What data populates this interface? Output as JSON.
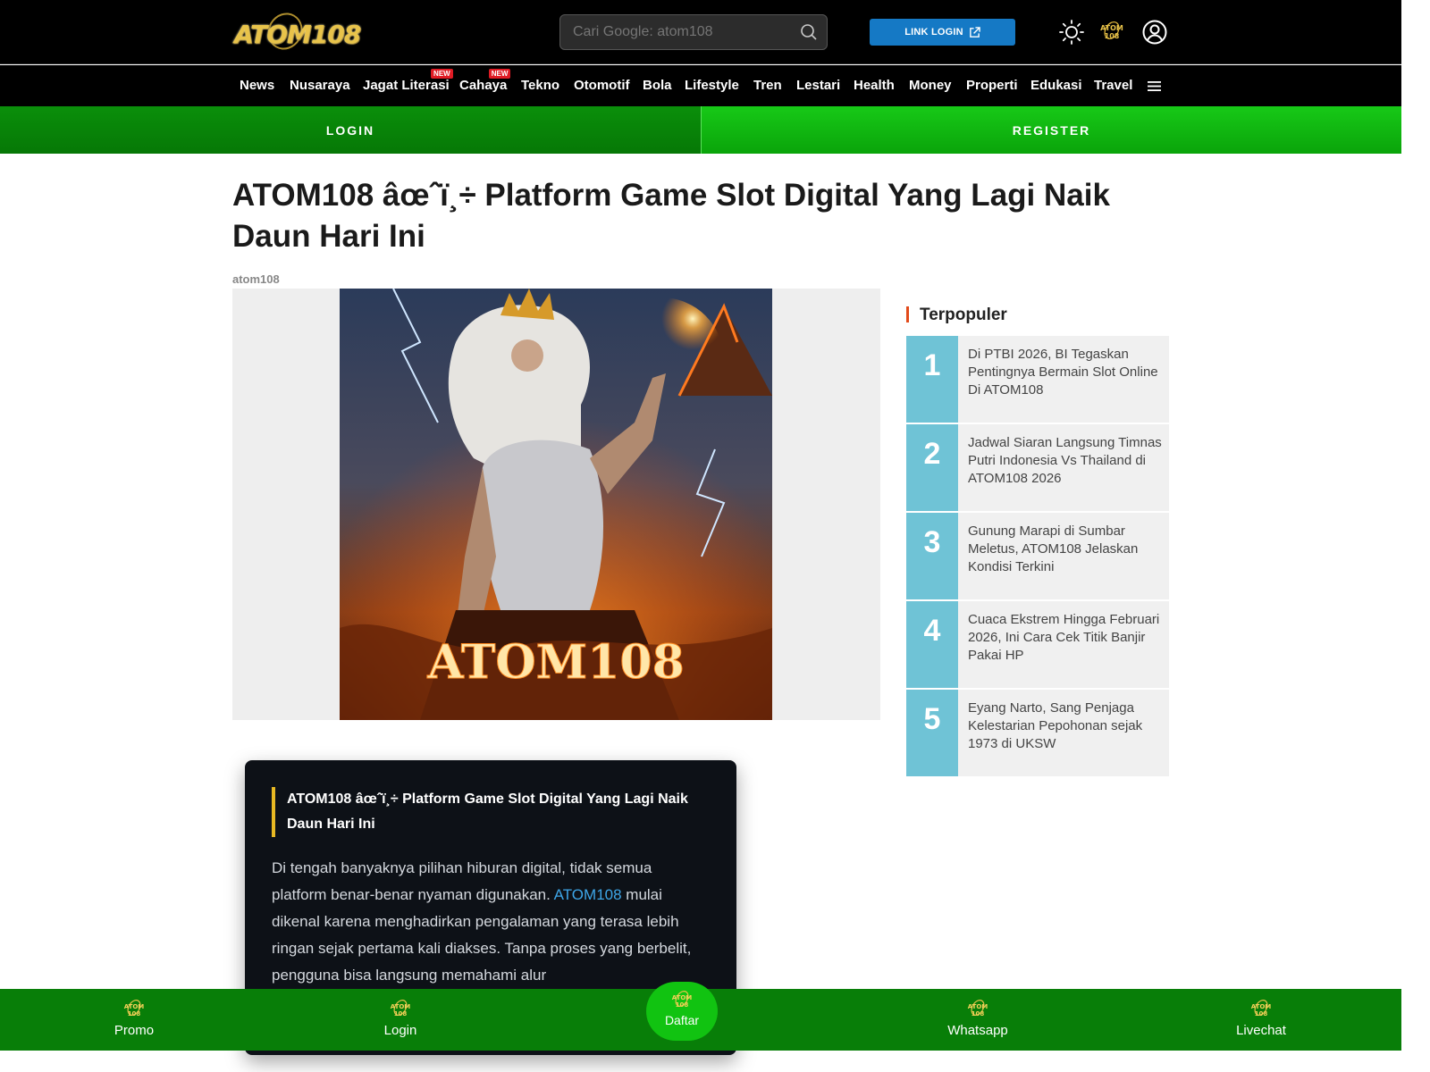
{
  "header": {
    "logo_text": "ATOM108",
    "search_placeholder": "Cari Google: atom108",
    "link_login_label": "LINK LOGIN",
    "mini_logo_text": "ATOM108"
  },
  "nav": {
    "items": [
      {
        "label": "News",
        "new": false
      },
      {
        "label": "Nusaraya",
        "new": false
      },
      {
        "label": "Jagat Literasi",
        "new": true
      },
      {
        "label": "Cahaya",
        "new": true
      },
      {
        "label": "Tekno",
        "new": false
      },
      {
        "label": "Otomotif",
        "new": false
      },
      {
        "label": "Bola",
        "new": false
      },
      {
        "label": "Lifestyle",
        "new": false
      },
      {
        "label": "Tren",
        "new": false
      },
      {
        "label": "Lestari",
        "new": false
      },
      {
        "label": "Health",
        "new": false
      },
      {
        "label": "Money",
        "new": false
      },
      {
        "label": "Properti",
        "new": false
      },
      {
        "label": "Edukasi",
        "new": false
      },
      {
        "label": "Travel",
        "new": false
      }
    ],
    "new_badge": "NEW"
  },
  "auth": {
    "login_label": "LOGIN",
    "register_label": "REGISTER"
  },
  "article": {
    "title": "ATOM108 âœˆï¸÷ Platform Game Slot Digital Yang Lagi Naik Daun Hari Ini",
    "author": "atom108",
    "hero_text": "ATOM108",
    "card_heading": "ATOM108 âœˆï¸÷ Platform Game Slot Digital Yang Lagi Naik Daun Hari Ini",
    "body_before_link": "Di tengah banyaknya pilihan hiburan digital, tidak semua platform benar-benar nyaman digunakan. ",
    "body_link": "ATOM108",
    "body_after_link": " mulai dikenal karena menghadirkan pengalaman yang terasa lebih ringan sejak pertama kali diakses. Tanpa proses yang berbelit, pengguna bisa langsung memahami alur"
  },
  "sidebar": {
    "title": "Terpopuler",
    "items": [
      {
        "num": "1",
        "text": "Di PTBI 2026, BI Tegaskan Pentingnya Bermain Slot Online Di ATOM108"
      },
      {
        "num": "2",
        "text": "Jadwal Siaran Langsung Timnas Putri Indonesia Vs Thailand di ATOM108 2026"
      },
      {
        "num": "3",
        "text": "Gunung Marapi di Sumbar Meletus, ATOM108 Jelaskan Kondisi Terkini"
      },
      {
        "num": "4",
        "text": "Cuaca Ekstrem Hingga Februari 2026, Ini Cara Cek Titik Banjir Pakai HP"
      },
      {
        "num": "5",
        "text": "Eyang Narto, Sang Penjaga Kelestarian Pepohonan sejak 1973 di UKSW"
      }
    ]
  },
  "bottombar": {
    "promo": "Promo",
    "login": "Login",
    "daftar": "Daftar",
    "whatsapp": "Whatsapp",
    "livechat": "Livechat"
  },
  "colors": {
    "nav_bg": "#000000",
    "login_green": "#078407",
    "register_green": "#12b812",
    "popular_number_bg": "#6fc3d6",
    "link_blue": "#3ea6e8",
    "accent_gold": "#e8b923"
  }
}
